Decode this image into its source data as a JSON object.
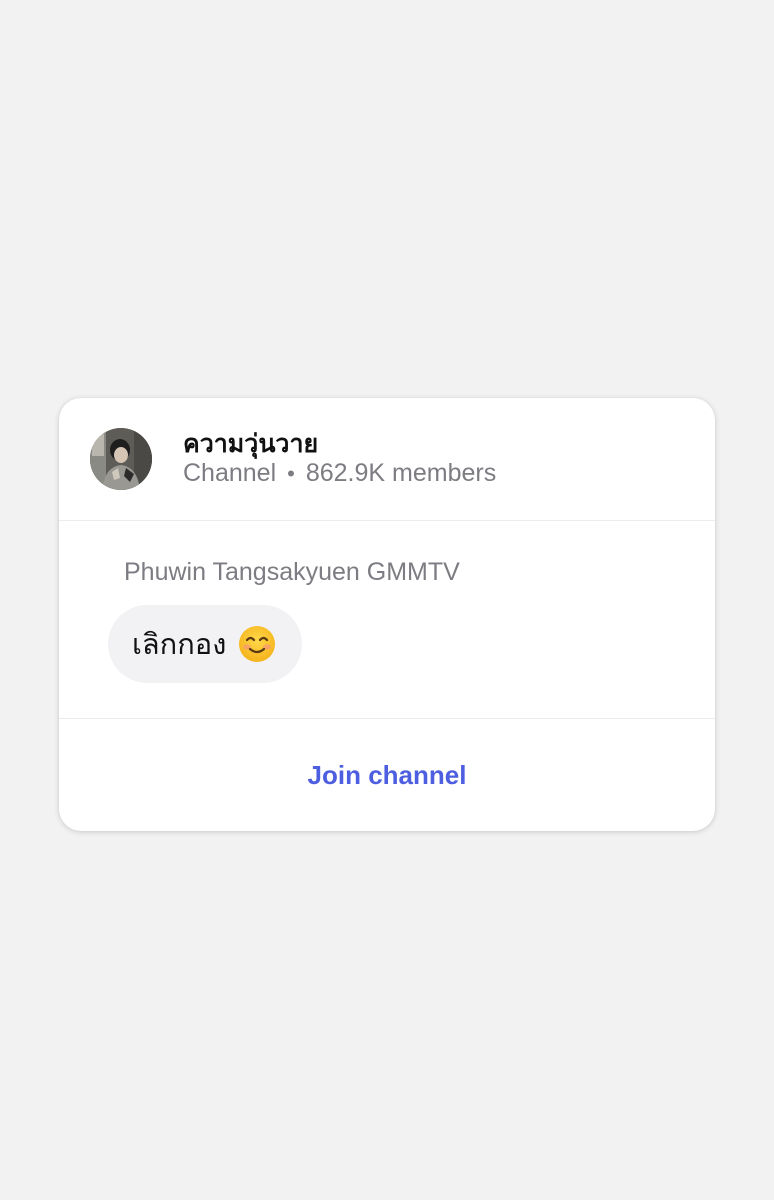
{
  "channel": {
    "name": "ความวุ่นวาย",
    "type_label": "Channel",
    "separator": "•",
    "members": "862.9K members"
  },
  "message": {
    "sender": "Phuwin Tangsakyuen GMMTV",
    "text": "เลิกกอง",
    "emoji": "smiling-face-with-smiling-eyes"
  },
  "actions": {
    "join_label": "Join channel"
  },
  "colors": {
    "page_background": "#f2f2f2",
    "card_background": "#ffffff",
    "accent": "#4d5fe0",
    "secondary_text": "#7c7c82",
    "bubble_background": "#f2f2f5"
  }
}
